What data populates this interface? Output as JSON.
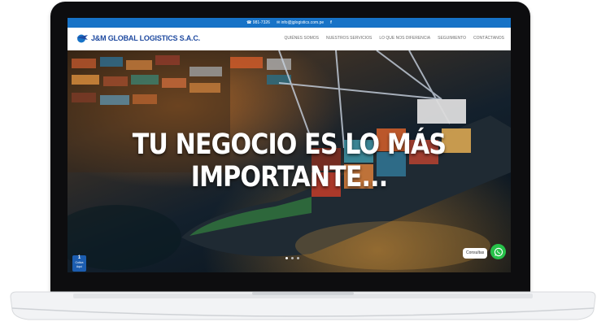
{
  "topbar": {
    "phone": "981-7326",
    "email": "info@jglogistics.com.pe"
  },
  "header": {
    "logo_text": "J&M GLOBAL LOGISTICS S.A.C."
  },
  "nav": {
    "items": [
      "Quiénes Somos",
      "Nuestros Servicios",
      "Lo que nos diferencia",
      "Seguimiento",
      "Contáctanos"
    ]
  },
  "hero": {
    "line1": "TU NEGOCIO ES LO MÁS",
    "line2": "IMPORTANTE..."
  },
  "badge": {
    "number": "1",
    "line1": "Cotiza",
    "line2": "Aquí"
  },
  "chat": {
    "label": "Consultas"
  },
  "colors": {
    "brand_blue": "#1773c7",
    "logo_blue": "#1f4aa0",
    "whatsapp_green": "#27c24a"
  }
}
